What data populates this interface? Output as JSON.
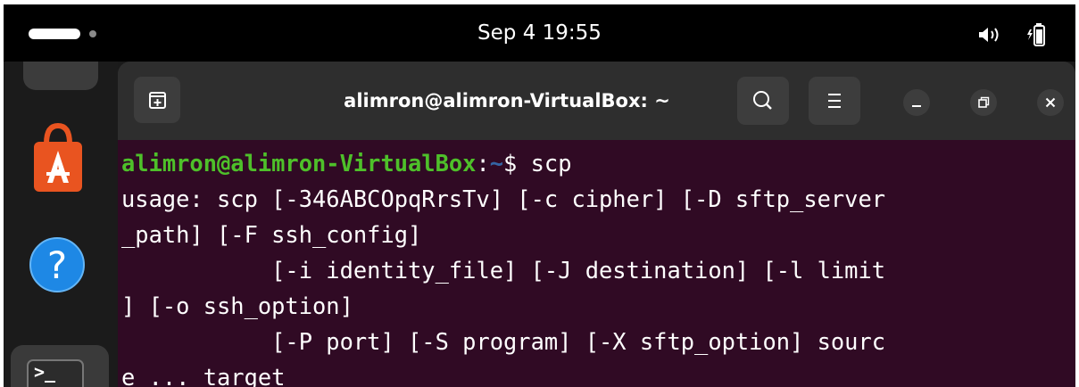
{
  "topbar": {
    "clock": "Sep 4  19:55",
    "icons": [
      "activities-indicator",
      "volume-icon",
      "battery-icon"
    ]
  },
  "dock": {
    "items": [
      {
        "name": "app-center",
        "icon": "app-center-icon"
      },
      {
        "name": "help",
        "icon": "help-icon",
        "glyph": "?"
      },
      {
        "name": "terminal",
        "icon": "terminal-icon",
        "glyph": ">_"
      }
    ]
  },
  "window": {
    "title": "alimron@alimron-VirtualBox: ~",
    "buttons": [
      "new-tab-icon",
      "search-icon",
      "hamburger-menu-icon",
      "minimize-icon",
      "maximize-icon",
      "close-icon"
    ]
  },
  "terminal": {
    "prompt_user_host": "alimron@alimron-VirtualBox",
    "prompt_sep": ":",
    "prompt_path": "~",
    "prompt_dollar": "$ ",
    "command": "scp",
    "output_lines": [
      "usage: scp [-346ABCOpqRrsTv] [-c cipher] [-D sftp_server",
      "_path] [-F ssh_config]",
      "           [-i identity_file] [-J destination] [-l limit",
      "] [-o ssh_option]",
      "           [-P port] [-S program] [-X sftp_option] sourc",
      "e ... target"
    ]
  },
  "colors": {
    "terminal_background": "#300a24",
    "prompt_user": "#4ec02a",
    "prompt_path": "#3465a4",
    "app_center_orange": "#e95420",
    "help_blue": "#1e88e5"
  }
}
